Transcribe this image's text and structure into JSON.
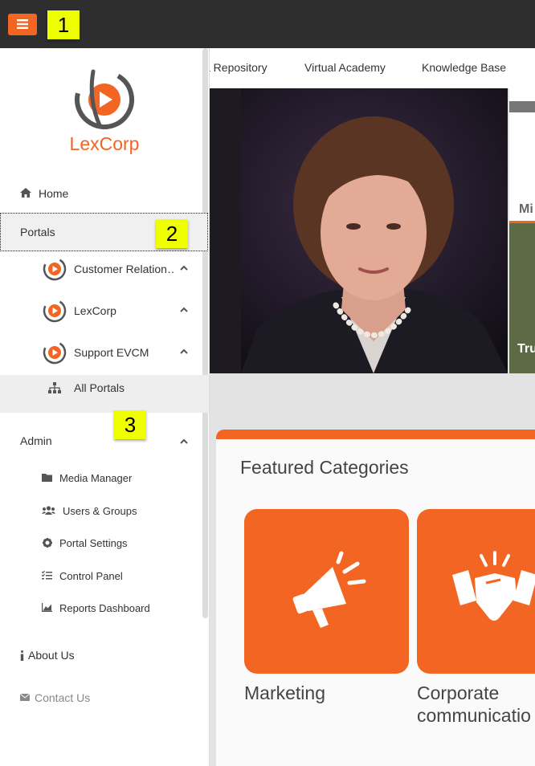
{
  "topbar": {
    "menu_icon": "hamburger-icon",
    "callout_1": "1"
  },
  "brand": {
    "name": "LexCorp",
    "accent": "#f26522"
  },
  "sidebar": {
    "home": "Home",
    "portals": "Portals",
    "callout_2": "2",
    "portal_items": [
      {
        "label": "Customer Relation…"
      },
      {
        "label": "LexCorp"
      },
      {
        "label": "Support EVCM"
      }
    ],
    "all_portals": "All Portals",
    "callout_3": "3",
    "admin": "Admin",
    "admin_items": [
      {
        "label": "Media Manager",
        "icon": "folder-icon"
      },
      {
        "label": "Users & Groups",
        "icon": "users-icon"
      },
      {
        "label": "Portal Settings",
        "icon": "gear-icon"
      },
      {
        "label": "Control Panel",
        "icon": "list-icon"
      },
      {
        "label": "Reports Dashboard",
        "icon": "chart-icon"
      }
    ],
    "about": "About Us",
    "contact": "Contact Us"
  },
  "topnav": {
    "items": [
      "a Repository",
      "Virtual Academy",
      "Knowledge Base"
    ]
  },
  "hero": {
    "side_text_1": "Mi",
    "side_text_2": "Tru"
  },
  "featured": {
    "title": "Featured Categories",
    "tiles": [
      {
        "label": "Marketing",
        "icon": "megaphone-icon"
      },
      {
        "label": "Corporate communication",
        "line1": "Corporate",
        "line2": "communicatio",
        "icon": "handshake-icon"
      }
    ]
  }
}
